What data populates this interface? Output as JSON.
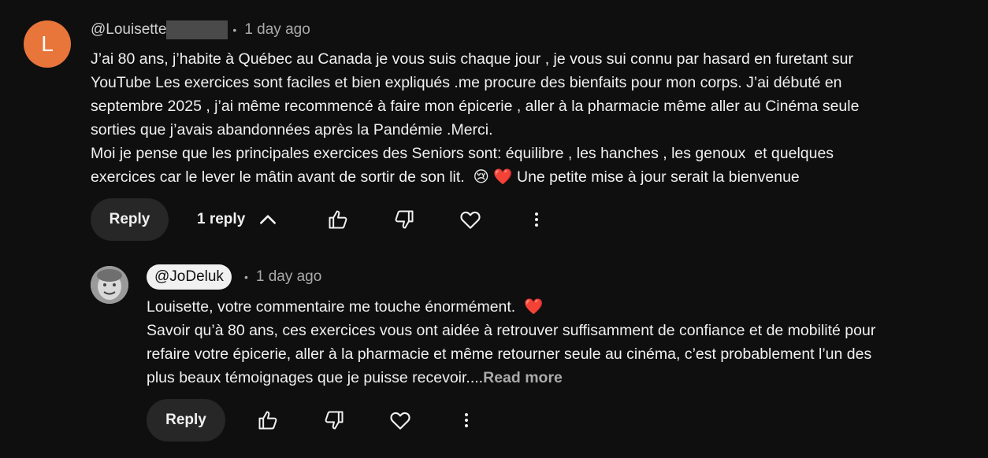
{
  "comment": {
    "avatar_letter": "L",
    "avatar_color": "#e8753a",
    "author": "@Louisette",
    "time": "1 day ago",
    "text": "J’ai 80 ans, j’habite à Québec au Canada je vous suis chaque jour , je vous sui connu par hasard en furetant sur\nYouTube Les exercices sont faciles et bien expliqués .me procure des bienfaits pour mon corps. J’ai débuté en\nseptembre 2025 , j’ai même recommencé à faire mon épicerie , aller à la pharmacie même aller au Cinéma seule\nsorties que j’avais abandonnées après la Pandémie .Merci.\nMoi je pense que les principales exercices des Seniors sont: équilibre , les hanches , les genoux  et quelques\nexercices car le lever le mâtin avant de sortir de son lit.  😢 ❤️ Une petite mise à jour serait la bienvenue",
    "reply_label": "Reply",
    "replies_label": "1 reply"
  },
  "reply": {
    "author": "@JoDeluk",
    "time": "1 day ago",
    "text": "Louisette, votre commentaire me touche énormément.  ❤️\nSavoir qu’à 80 ans, ces exercices vous ont aidée à retrouver suffisamment de confiance et de mobilité pour\nrefaire votre épicerie, aller à la pharmacie et même retourner seule au cinéma, c’est probablement l’un des\nplus beaux témoignages que je puisse recevoir....",
    "read_more": "Read more",
    "reply_label": "Reply"
  },
  "icons": [
    "thumb-up-icon",
    "thumb-down-icon",
    "heart-icon",
    "more-vert-icon",
    "chevron-up-icon"
  ]
}
